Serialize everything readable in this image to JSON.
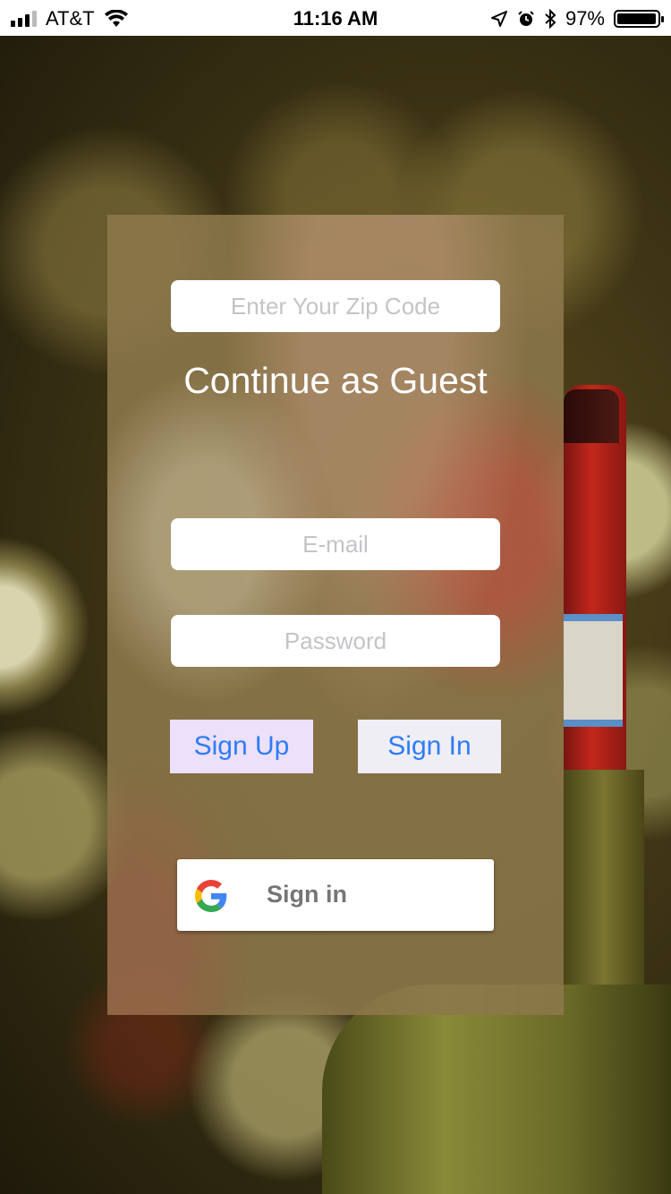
{
  "status_bar": {
    "carrier": "AT&T",
    "time": "11:16 AM",
    "battery_percent": "97%",
    "battery_level": 0.97,
    "signal_bars_filled": 3,
    "signal_bars_total": 4,
    "icons": [
      "wifi-icon",
      "location-arrow-icon",
      "alarm-icon",
      "bluetooth-icon",
      "battery-icon"
    ]
  },
  "form": {
    "zip_placeholder": "Enter Your Zip Code",
    "guest_label": "Continue as Guest",
    "email_placeholder": "E-mail",
    "password_placeholder": "Password",
    "signup_label": "Sign Up",
    "signin_label": "Sign In"
  },
  "google": {
    "label": "Sign in",
    "icon": "google-g-icon"
  },
  "colors": {
    "button_text": "#2f7cf6",
    "signup_bg": "#ece0fb",
    "signin_bg": "#eeeef4"
  }
}
